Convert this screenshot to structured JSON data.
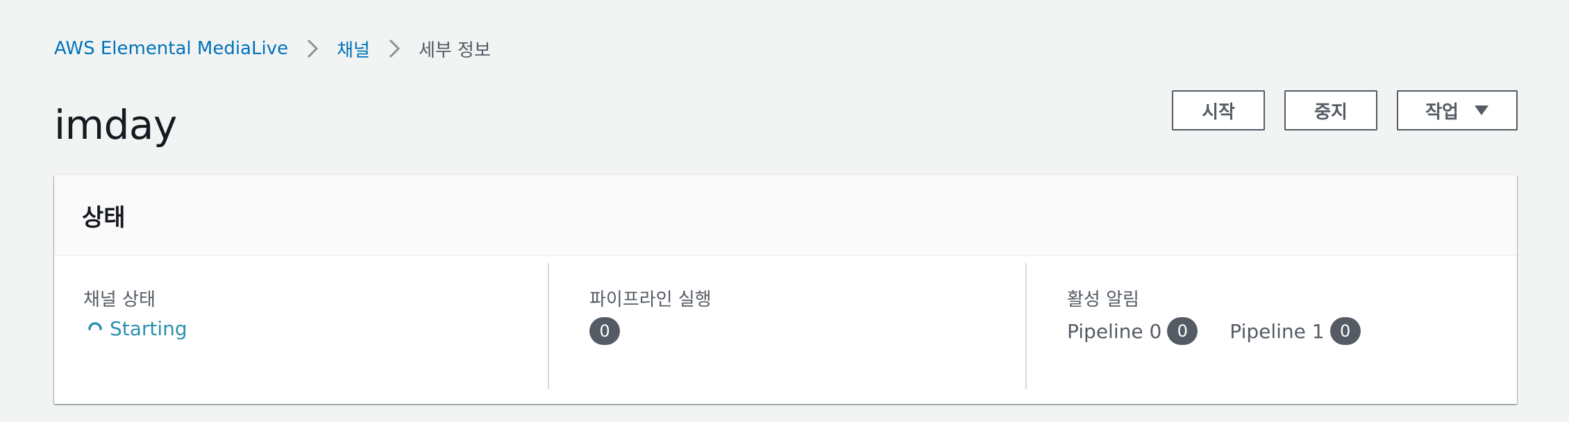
{
  "breadcrumb": {
    "items": [
      {
        "label": "AWS Elemental MediaLive",
        "link": true
      },
      {
        "label": "채널",
        "link": true
      },
      {
        "label": "세부 정보",
        "link": false
      }
    ]
  },
  "page": {
    "title": "imday"
  },
  "actions": {
    "start_label": "시작",
    "stop_label": "중지",
    "actions_label": "작업"
  },
  "status_panel": {
    "title": "상태",
    "channel_state": {
      "label": "채널 상태",
      "value": "Starting"
    },
    "pipelines_running": {
      "label": "파이프라인 실행",
      "count": "0"
    },
    "active_alerts": {
      "label": "활성 알림",
      "pipelines": [
        {
          "name": "Pipeline 0",
          "count": "0"
        },
        {
          "name": "Pipeline 1",
          "count": "0"
        }
      ]
    }
  },
  "colors": {
    "link": "#0073bb",
    "status_starting": "#2d8fb0",
    "badge": "#545b64",
    "background": "#f2f3f3"
  },
  "icons": [
    "chevron-right-icon",
    "caret-down-icon",
    "spinner-icon"
  ]
}
